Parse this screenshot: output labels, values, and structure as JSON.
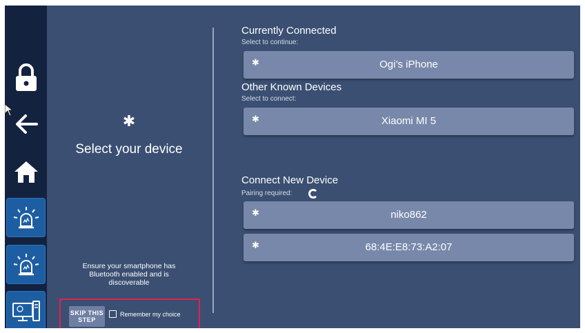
{
  "left_panel": {
    "title": "Select your device",
    "bluetooth_glyph": "✱",
    "info": "Ensure your smartphone has Bluetooth enabled and is discoverable",
    "skip_label_line1": "SKIP THIS",
    "skip_label_line2": "STEP",
    "remember_label": "Remember my choice"
  },
  "sidebar": {
    "items": [
      {
        "icon": "lock-icon"
      },
      {
        "icon": "back-arrow-icon"
      },
      {
        "icon": "home-icon"
      },
      {
        "icon": "siren-icon"
      },
      {
        "icon": "siren-icon"
      },
      {
        "icon": "computer-monitor-icon"
      }
    ]
  },
  "connected": {
    "title": "Currently Connected",
    "subtitle": "Select to continue:",
    "devices": [
      {
        "name": "Ogi’s iPhone"
      }
    ]
  },
  "known": {
    "title": "Other Known Devices",
    "subtitle": "Select to connect:",
    "devices": [
      {
        "name": "Xiaomi MI 5"
      }
    ]
  },
  "new_devices": {
    "title": "Connect New Device",
    "subtitle": "Pairing required:",
    "devices": [
      {
        "name": "niko862"
      },
      {
        "name": "68:4E:E8:73:A2:07"
      }
    ]
  },
  "colors": {
    "background": "#3a4f72",
    "sidebar": "#13223f",
    "device_row": "#7888aa",
    "highlight_border": "#e3224c",
    "sidebar_button": "#1d5ea3"
  }
}
